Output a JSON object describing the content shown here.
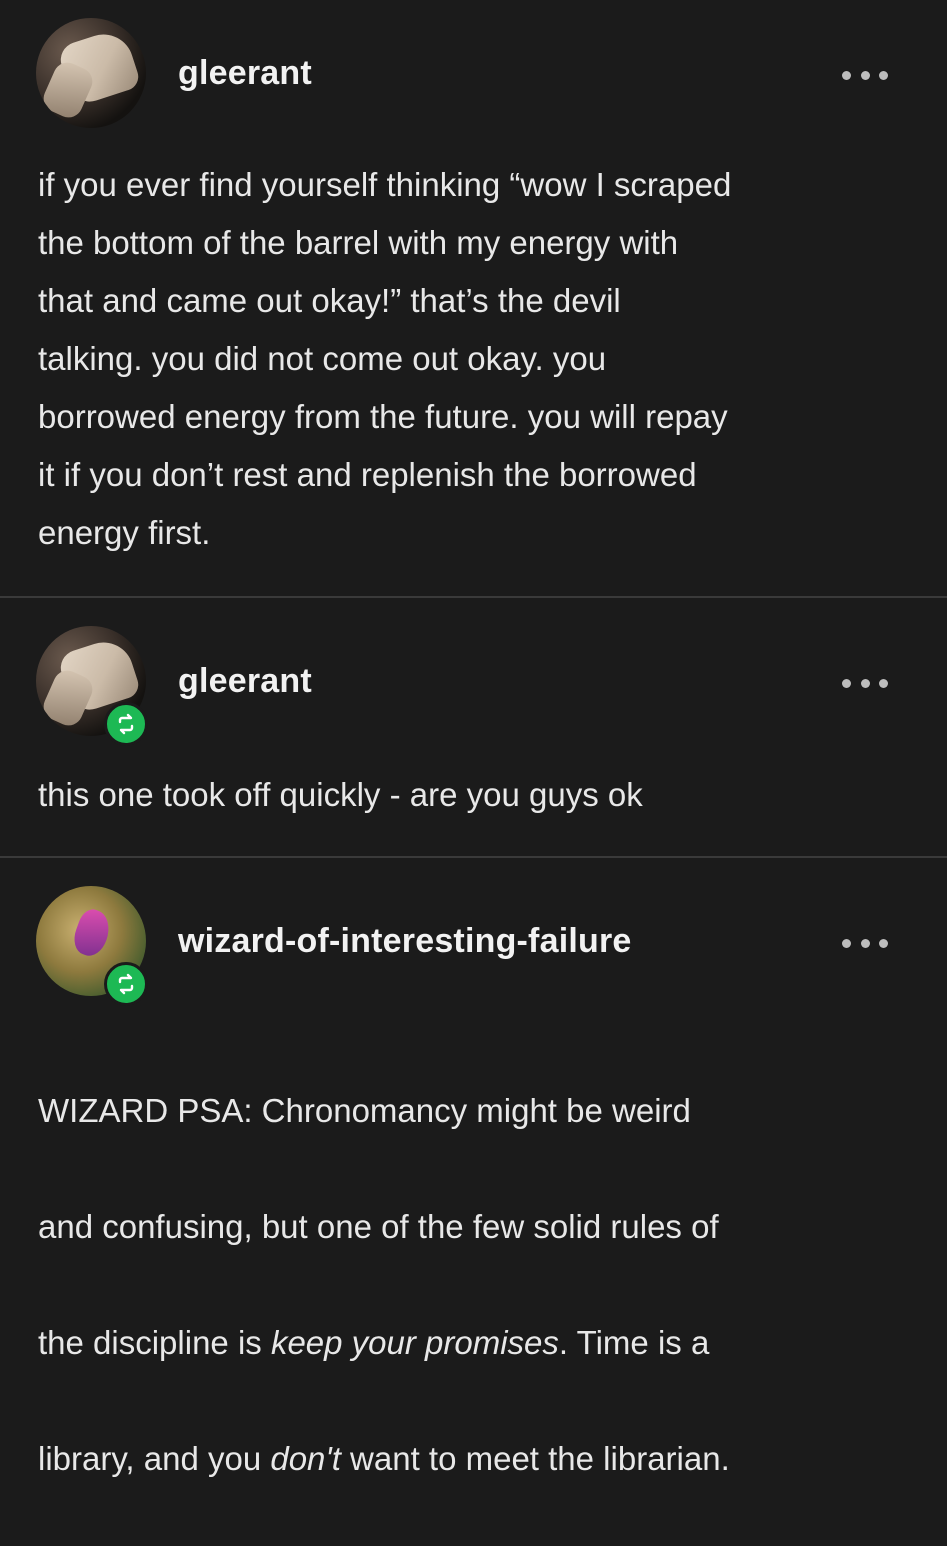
{
  "posts": [
    {
      "username": "gleerant",
      "reblog": false,
      "body": "if you ever find yourself thinking “wow I scraped\nthe bottom of the barrel with my energy with\nthat and came out okay!” that’s the devil\ntalking. you did not come out okay. you\nborrowed energy from the future. you will repay\nit if you don’t rest and replenish the borrowed\nenergy first."
    },
    {
      "username": "gleerant",
      "reblog": true,
      "body": "this one took off quickly - are you guys ok"
    },
    {
      "username": "wizard-of-interesting-failure",
      "reblog": true,
      "body_parts": {
        "line1": "WIZARD PSA: Chronomancy might be weird",
        "line2": "and confusing, but one of the few solid rules of",
        "line3_pre": "the discipline is ",
        "line3_em": "keep your promises",
        "line3_post": ". Time is a",
        "line4_pre": "library, and you ",
        "line4_em": "don't",
        "line4_post": " want to meet the librarian."
      }
    }
  ],
  "icons": {
    "more": "more-horizontal-icon",
    "reblog": "reblog-icon"
  },
  "colors": {
    "background": "#1b1b1b",
    "reblog_badge": "#1db954",
    "text": "#e8e8e8"
  }
}
